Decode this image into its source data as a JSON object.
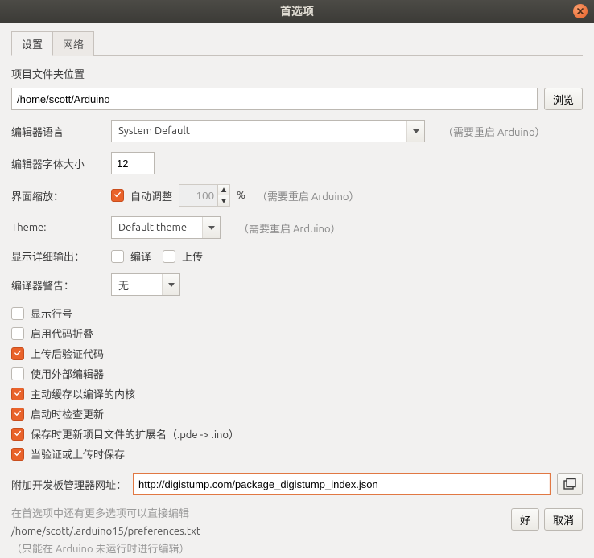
{
  "window": {
    "title": "首选项"
  },
  "tabs": {
    "settings": "设置",
    "network": "网络"
  },
  "sketchbook": {
    "label": "项目文件夹位置",
    "path": "/home/scott/Arduino",
    "browse": "浏览"
  },
  "editor_lang": {
    "label": "编辑器语言",
    "value": "System Default",
    "restart": "（需要重启 Arduino）"
  },
  "font_size": {
    "label": "编辑器字体大小",
    "value": "12"
  },
  "scale": {
    "label": "界面缩放：",
    "auto_label": "自动调整",
    "auto_checked": true,
    "value": "100",
    "pct": "%",
    "restart": "（需要重启 Arduino）"
  },
  "theme": {
    "label": "Theme:",
    "value": "Default theme",
    "restart": "（需要重启 Arduino）"
  },
  "verbose": {
    "label": "显示详细输出：",
    "compile_label": "编译",
    "compile_checked": false,
    "upload_label": "上传",
    "upload_checked": false
  },
  "warnings": {
    "label": "编译器警告：",
    "value": "无"
  },
  "opts": {
    "line_numbers": {
      "label": "显示行号",
      "checked": false
    },
    "code_folding": {
      "label": "启用代码折叠",
      "checked": false
    },
    "verify_upload": {
      "label": "上传后验证代码",
      "checked": true
    },
    "external_editor": {
      "label": "使用外部编辑器",
      "checked": false
    },
    "cache_cores": {
      "label": "主动缓存以编译的内核",
      "checked": true
    },
    "check_updates": {
      "label": "启动时检查更新",
      "checked": true
    },
    "update_ext": {
      "label": "保存时更新项目文件的扩展名（.pde -> .ino）",
      "checked": true
    },
    "save_verify": {
      "label": "当验证或上传时保存",
      "checked": true
    }
  },
  "boards_url": {
    "label": "附加开发板管理器网址：",
    "value": "http://digistump.com/package_digistump_index.json"
  },
  "footer": {
    "line1": "在首选项中还有更多选项可以直接编辑",
    "path": "/home/scott/.arduino15/preferences.txt",
    "line3": "（只能在 Arduino 未运行时进行编辑）"
  },
  "buttons": {
    "ok": "好",
    "cancel": "取消"
  }
}
